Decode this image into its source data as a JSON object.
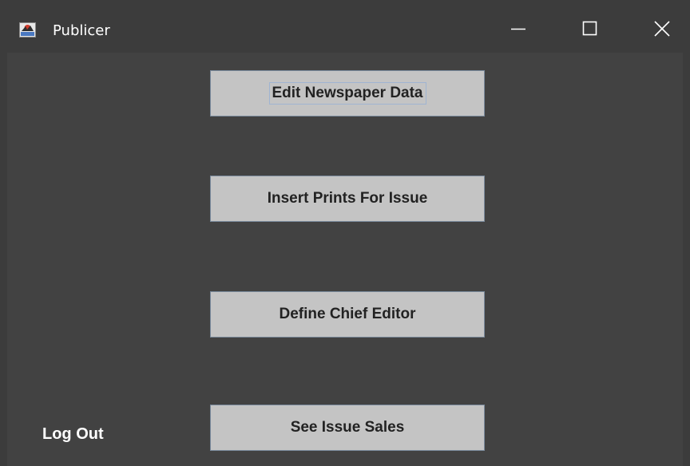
{
  "window": {
    "title": "Publicer",
    "icon": "java-app-icon",
    "controls": [
      "minimize-icon",
      "maximize-icon",
      "close-icon"
    ]
  },
  "main": {
    "buttons": [
      {
        "label": "Edit Newspaper Data",
        "focused": true
      },
      {
        "label": "Insert Prints For Issue",
        "focused": false
      },
      {
        "label": "Define Chief Editor",
        "focused": false
      },
      {
        "label": "See Issue Sales",
        "focused": false
      }
    ],
    "logout_label": "Log Out"
  },
  "colors": {
    "titlebar": "#3c3c3c",
    "background": "#424242",
    "button_face": "#c4c4c4",
    "button_text": "#222222",
    "focus_outline": "#9fb4d2",
    "text_light": "#ffffff"
  }
}
